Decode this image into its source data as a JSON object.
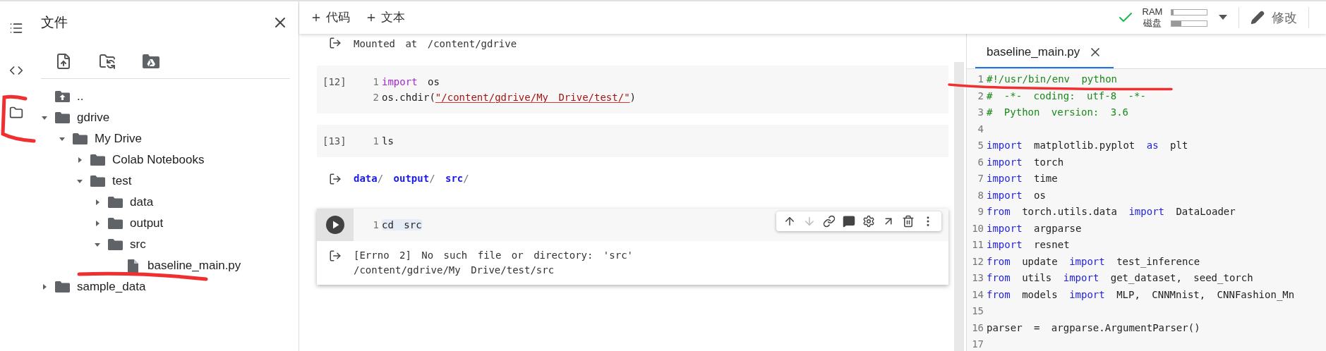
{
  "files_panel": {
    "title": "文件",
    "tree": [
      {
        "name": "..",
        "kind": "parent"
      },
      {
        "name": "gdrive",
        "kind": "folder",
        "expanded": true,
        "children": [
          {
            "name": "My Drive",
            "kind": "folder",
            "expanded": true,
            "children": [
              {
                "name": "Colab Notebooks",
                "kind": "folder",
                "expanded": false
              },
              {
                "name": "test",
                "kind": "folder",
                "expanded": true,
                "children": [
                  {
                    "name": "data",
                    "kind": "folder",
                    "expanded": false
                  },
                  {
                    "name": "output",
                    "kind": "folder",
                    "expanded": false
                  },
                  {
                    "name": "src",
                    "kind": "folder",
                    "expanded": true,
                    "children": [
                      {
                        "name": "baseline_main.py",
                        "kind": "file"
                      }
                    ]
                  }
                ]
              }
            ]
          }
        ]
      },
      {
        "name": "sample_data",
        "kind": "folder",
        "expanded": false
      }
    ]
  },
  "toolbar": {
    "buttons": [
      {
        "label": "代码"
      },
      {
        "label": "文本"
      }
    ]
  },
  "runtime": {
    "connected": true,
    "resources": [
      {
        "label": "RAM",
        "level": 0.05
      },
      {
        "label": "磁盘",
        "level": 0.28
      }
    ],
    "edit_button": "修改"
  },
  "notebook": {
    "cells": [
      {
        "kind": "output",
        "output": [
          {
            "tokens": [
              {
                "text": "Mounted at /content/gdrive",
                "kind": "plain"
              }
            ]
          }
        ]
      },
      {
        "kind": "code",
        "count": "[12]",
        "selected": false,
        "lines": [
          {
            "number": "1",
            "tokens": [
              {
                "text": "import",
                "kind": "keyword"
              },
              {
                "text": " os",
                "kind": "plain"
              }
            ]
          },
          {
            "number": "2",
            "tokens": [
              {
                "text": "os.chdir(",
                "kind": "plain"
              },
              {
                "text": "\"/content/gdrive/My Drive/test/\"",
                "kind": "string"
              },
              {
                "text": ")",
                "kind": "plain"
              }
            ]
          }
        ]
      },
      {
        "kind": "code",
        "count": "[13]",
        "selected": false,
        "lines": [
          {
            "number": "1",
            "tokens": [
              {
                "text": "ls",
                "kind": "plain"
              }
            ]
          }
        ],
        "output": [
          {
            "tokens": [
              {
                "text": "data",
                "kind": "dir"
              },
              {
                "text": "/ ",
                "kind": "punct"
              },
              {
                "text": "output",
                "kind": "dir"
              },
              {
                "text": "/ ",
                "kind": "punct"
              },
              {
                "text": "src",
                "kind": "dir"
              },
              {
                "text": "/",
                "kind": "punct"
              }
            ]
          }
        ]
      },
      {
        "kind": "code",
        "selected": true,
        "lines": [
          {
            "number": "1",
            "tokens": [
              {
                "text": "cd src",
                "kind": "selection"
              }
            ]
          }
        ],
        "output": [
          {
            "tokens": [
              {
                "text": "[Errno 2] No such file or directory: 'src'",
                "kind": "plain"
              }
            ]
          },
          {
            "tokens": [
              {
                "text": "/content/gdrive/My Drive/test/src",
                "kind": "plain"
              }
            ]
          }
        ]
      }
    ]
  },
  "editor": {
    "tabs": [
      {
        "title": "baseline_main.py",
        "selected": true
      }
    ],
    "lines": [
      {
        "number": "1",
        "tokens": [
          {
            "text": "#!/usr/bin/env python",
            "kind": "comment"
          }
        ]
      },
      {
        "number": "2",
        "tokens": [
          {
            "text": "# -*- coding: utf-8 -*-",
            "kind": "comment"
          }
        ]
      },
      {
        "number": "3",
        "tokens": [
          {
            "text": "# Python version: 3.6",
            "kind": "comment"
          }
        ]
      },
      {
        "number": "4"
      },
      {
        "number": "5",
        "tokens": [
          {
            "text": "import",
            "kind": "keyword"
          },
          {
            "text": " matplotlib.pyplot ",
            "kind": "plain"
          },
          {
            "text": "as",
            "kind": "keyword"
          },
          {
            "text": " plt",
            "kind": "plain"
          }
        ]
      },
      {
        "number": "6",
        "tokens": [
          {
            "text": "import",
            "kind": "keyword"
          },
          {
            "text": " torch",
            "kind": "plain"
          }
        ]
      },
      {
        "number": "7",
        "tokens": [
          {
            "text": "import",
            "kind": "keyword"
          },
          {
            "text": " time",
            "kind": "plain"
          }
        ]
      },
      {
        "number": "8",
        "tokens": [
          {
            "text": "import",
            "kind": "keyword"
          },
          {
            "text": " os",
            "kind": "plain"
          }
        ]
      },
      {
        "number": "9",
        "tokens": [
          {
            "text": "from",
            "kind": "keyword"
          },
          {
            "text": " torch.utils.data ",
            "kind": "plain"
          },
          {
            "text": "import",
            "kind": "keyword"
          },
          {
            "text": " DataLoader",
            "kind": "plain"
          }
        ]
      },
      {
        "number": "10",
        "tokens": [
          {
            "text": "import",
            "kind": "keyword"
          },
          {
            "text": " argparse",
            "kind": "plain"
          }
        ]
      },
      {
        "number": "11",
        "tokens": [
          {
            "text": "import",
            "kind": "keyword"
          },
          {
            "text": " resnet",
            "kind": "plain"
          }
        ]
      },
      {
        "number": "12",
        "tokens": [
          {
            "text": "from",
            "kind": "keyword"
          },
          {
            "text": " update ",
            "kind": "plain"
          },
          {
            "text": "import",
            "kind": "keyword"
          },
          {
            "text": " test_inference",
            "kind": "plain"
          }
        ]
      },
      {
        "number": "13",
        "tokens": [
          {
            "text": "from",
            "kind": "keyword"
          },
          {
            "text": " utils ",
            "kind": "plain"
          },
          {
            "text": "import",
            "kind": "keyword"
          },
          {
            "text": " get_dataset, seed_torch",
            "kind": "plain"
          }
        ]
      },
      {
        "number": "14",
        "tokens": [
          {
            "text": "from",
            "kind": "keyword"
          },
          {
            "text": " models ",
            "kind": "plain"
          },
          {
            "text": "import",
            "kind": "keyword"
          },
          {
            "text": " MLP, CNNMnist, CNNFashion_Mn",
            "kind": "plain"
          }
        ]
      },
      {
        "number": "15"
      },
      {
        "number": "16",
        "tokens": [
          {
            "text": "parser = argparse.ArgumentParser()",
            "kind": "plain"
          }
        ]
      },
      {
        "number": "17"
      }
    ]
  }
}
